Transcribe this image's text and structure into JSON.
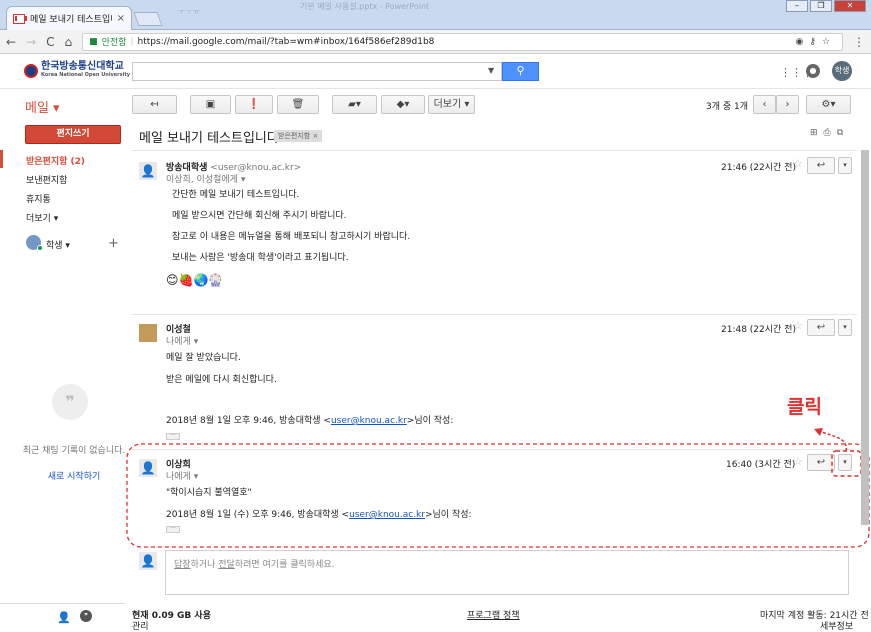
{
  "browser": {
    "tab_title": "메일 보내기 테스트입니다",
    "tab_close": "×",
    "faint_tab": "ㅜㅜㅠ",
    "faint_title": "기본 메일 사용설.pptx - PowerPoint",
    "secure_label": "안전함",
    "url": "https://mail.google.com/mail/?tab=wm#inbox/164f586ef289d1b8",
    "icons": [
      "back-icon",
      "forward-icon",
      "reload-icon",
      "home-icon",
      "lock-icon",
      "eye-icon",
      "key-icon",
      "star-icon",
      "menu-icon"
    ]
  },
  "header": {
    "logo_text": "한국방송통신대학교",
    "logo_sub": "Korea National Open University",
    "avatar_text": "학생"
  },
  "toolbar": {
    "mail_label": "메일 ▾",
    "more_label": "더보기 ▾",
    "pager_text": "3개 중 1개"
  },
  "sidebar": {
    "compose": "편지쓰기",
    "items": [
      "받은편지함 (2)",
      "보낸편지함",
      "휴지통",
      "더보기 ▾"
    ],
    "user_name": "학생 ▾",
    "chat_empty": "최근 채팅 기록이 없습니다.",
    "chat_start": "새로 시작하기"
  },
  "thread": {
    "subject": "메일 보내기 테스트입니다.",
    "label": "받은편지함",
    "label_x": "×",
    "messages": [
      {
        "sender": "방송대학생",
        "email": "<user@knou.ac.kr>",
        "to": "이상희, 이성철에게",
        "time": "21:46 (22시간 전)",
        "lines": [
          "간단한 메일 보내기 테스트입니다.",
          "메일 받으시면 간단해 회신해 주시기 바랍니다.",
          "참고로 이 내용은 메뉴얼을 통해 배포되니 참고하시기 바랍니다.",
          "보내는 사람은 '방송대 학생'이라고 표기됩니다."
        ],
        "emoji": "😊🍓🌏🎡"
      },
      {
        "sender": "이성철",
        "to": "나에게",
        "time": "21:48 (22시간 전)",
        "lines": [
          "메일 잘 받았습니다.",
          "받은 메일에 다시 회신합니다."
        ],
        "quote_pre": "2018년 8월 1일 오후 9:46, 방송대학생 <",
        "quote_link": "user@knou.ac.kr",
        "quote_post": ">님이 작성:"
      },
      {
        "sender": "이상희",
        "to": "나에게",
        "time": "16:40 (3시간 전)",
        "lines": [
          "\"학이시습지 불역열호\""
        ],
        "quote_pre": "2018년 8월 1일 (수) 오후 9:46, 방송대학생 <",
        "quote_link": "user@knou.ac.kr",
        "quote_post": ">님이 작성:"
      }
    ],
    "reply_hint_a": "답장",
    "reply_hint_b": "하거나 ",
    "reply_hint_c": "전달",
    "reply_hint_d": "하려면 여기를 클릭하세요."
  },
  "annotation": {
    "click_label": "클릭",
    "color": "#e03131"
  },
  "footer": {
    "usage": "현재 0.09 GB 사용",
    "manage": "관리",
    "policy": "프로그램 정책",
    "last_activity": "마지막 계정 활동: 21시간 전",
    "details": "세부정보"
  }
}
